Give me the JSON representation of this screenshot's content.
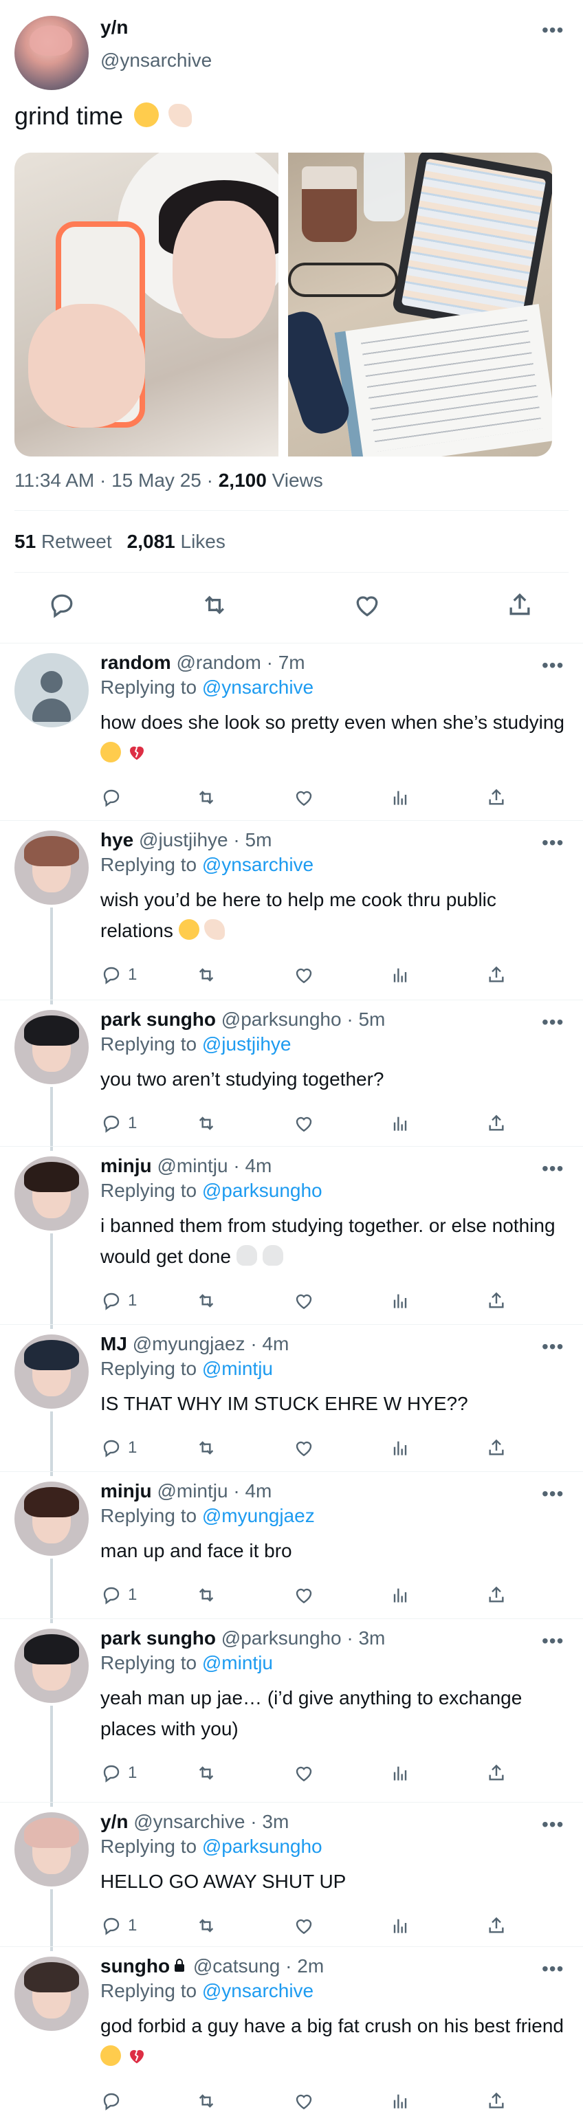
{
  "main": {
    "name": "y/n",
    "handle": "@ynsarchive",
    "text": "grind time",
    "emoji_after_text": [
      "persevering-face",
      "flexed-biceps-light-skin"
    ],
    "time": "11:34 AM · 15 May 25 · ",
    "views_count": "2,100",
    "views_label": " Views",
    "retweet_count": "51",
    "retweet_label": "Retweet",
    "likes_count": "2,081",
    "likes_label": "Likes",
    "more_glyph": "•••"
  },
  "replies": [
    {
      "name": "random",
      "handle": "@random",
      "time": "· 7m",
      "replying_label": "Replying to ",
      "replying_to": "@ynsarchive",
      "text": "how does she look so pretty even when she’s studying",
      "emoji": [
        "loudly-crying-face",
        "broken-heart"
      ],
      "reply_count": "",
      "avatar": "default-avatar"
    },
    {
      "name": "hye",
      "handle": "@justjihye",
      "time": "· 5m",
      "replying_label": "Replying to ",
      "replying_to": "@ynsarchive",
      "text": "wish you’d be here to help me cook thru public relations",
      "emoji": [
        "persevering-face",
        "flexed-biceps-light-skin"
      ],
      "reply_count": "1",
      "avatar": "photo-avatar"
    },
    {
      "name": "park sungho",
      "handle": "@parksungho",
      "time": "· 5m",
      "replying_label": "Replying to ",
      "replying_to": "@justjihye",
      "text": "you two aren’t studying together?",
      "emoji": [],
      "reply_count": "1",
      "avatar": "photo-avatar"
    },
    {
      "name": "minju",
      "handle": "@mintju",
      "time": "· 4m",
      "replying_label": "Replying to ",
      "replying_to": "@parksungho",
      "text": "i banned them from studying together. or else nothing would get done",
      "emoji": [
        "skull",
        "skull"
      ],
      "reply_count": "1",
      "avatar": "photo-avatar"
    },
    {
      "name": "MJ",
      "handle": "@myungjaez",
      "time": "· 4m",
      "replying_label": "Replying to ",
      "replying_to": "@mintju",
      "text": "IS THAT WHY IM STUCK EHRE W HYE??",
      "emoji": [],
      "reply_count": "1",
      "avatar": "photo-avatar"
    },
    {
      "name": "minju",
      "handle": "@mintju",
      "time": "· 4m",
      "replying_label": "Replying to ",
      "replying_to": "@myungjaez",
      "text": "man up and face it bro",
      "emoji": [],
      "reply_count": "1",
      "avatar": "photo-avatar"
    },
    {
      "name": "park sungho",
      "handle": "@parksungho",
      "time": "· 3m",
      "replying_label": "Replying to ",
      "replying_to": "@mintju",
      "text": "yeah man up jae… (i’d give anything to exchange places with you)",
      "emoji": [],
      "reply_count": "1",
      "avatar": "photo-avatar"
    },
    {
      "name": "y/n",
      "handle": "@ynsarchive",
      "time": "· 3m",
      "replying_label": "Replying to ",
      "replying_to": "@parksungho",
      "text": "HELLO GO AWAY SHUT UP",
      "emoji": [],
      "reply_count": "1",
      "avatar": "photo-avatar"
    },
    {
      "name": "sungho",
      "handle": "@catsung",
      "time": "· 2m",
      "replying_label": "Replying to ",
      "replying_to": "@ynsarchive",
      "text": "god forbid a guy have a big fat crush on his best friend",
      "emoji": [
        "disappointed-face",
        "broken-heart"
      ],
      "reply_count": "",
      "avatar": "photo-avatar",
      "locked": true
    }
  ],
  "colors": {
    "link": "#1d9bf0",
    "secondary_text": "#536471",
    "primary_text": "#0f1419",
    "divider": "#eff3f4",
    "thread_line": "#cfd9de"
  },
  "icons": [
    "reply-icon",
    "retweet-icon",
    "like-icon",
    "views-icon",
    "share-icon",
    "more-icon",
    "lock-icon"
  ]
}
